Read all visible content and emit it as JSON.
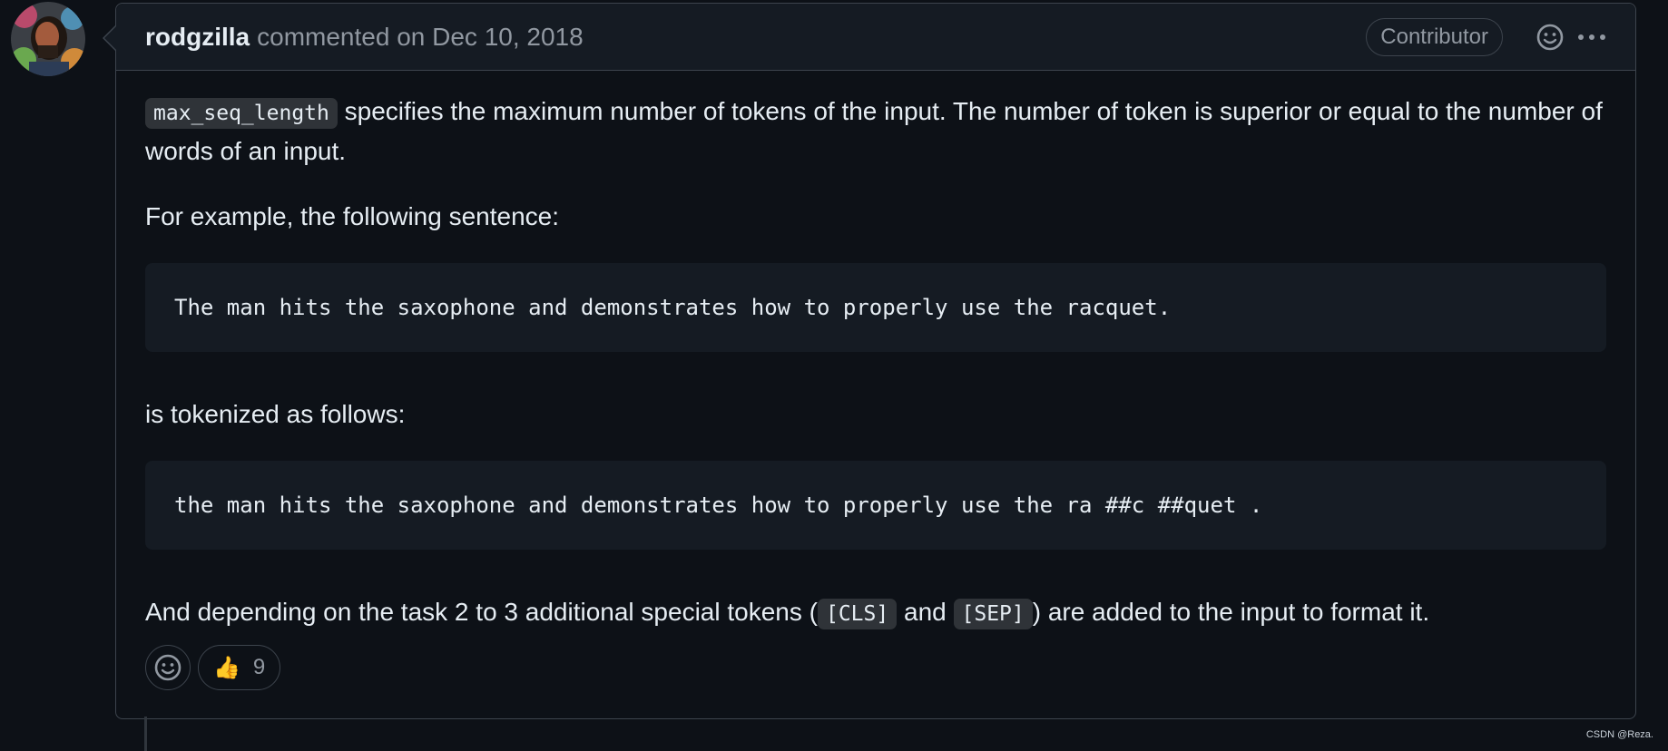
{
  "comment": {
    "author": "rodgzilla",
    "meta": "commented on Dec 10, 2018",
    "badge": "Contributor",
    "icons": {
      "react": "smiley-icon",
      "menu": "kebab-menu-icon"
    }
  },
  "body": {
    "p1_code": "max_seq_length",
    "p1_text": " specifies the maximum number of tokens of the input. The number of token is superior or equal to the number of words of an input.",
    "p2": "For example, the following sentence:",
    "code1": "The man hits the saxophone and demonstrates how to properly use the racquet.",
    "p3": "is tokenized as follows:",
    "code2": "the man hits the saxophone and demonstrates how to properly use the ra ##c ##quet .",
    "p4_before": "And depending on the task 2 to 3 additional special tokens (",
    "p4_code1": "[CLS]",
    "p4_mid": " and ",
    "p4_code2": "[SEP]",
    "p4_after": ") are added to the input to format it."
  },
  "reactions": {
    "add_icon": "smiley-icon",
    "thumbs_up_icon": "thumbs-up-icon",
    "thumbs_up_glyph": "👍",
    "thumbs_up_count": "9"
  },
  "watermark": "CSDN @Reza.",
  "colors": {
    "background": "#0d1117",
    "header_bg": "#151b23",
    "border": "#3d444d",
    "text": "#e6edf3",
    "muted": "#9198a1"
  }
}
